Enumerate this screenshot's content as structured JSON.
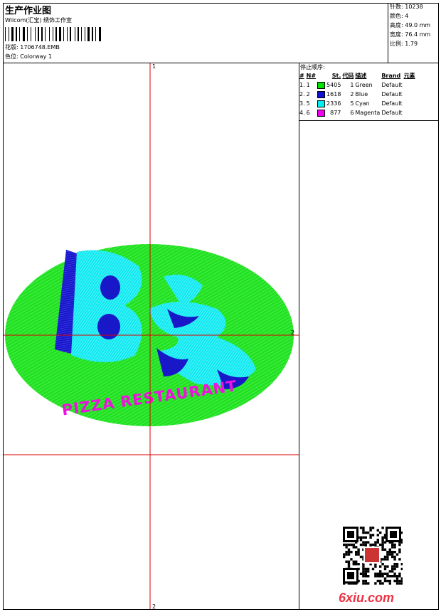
{
  "header": {
    "title": "生产作业图",
    "company": "Wilcom(汇宝) 绣饰工作室",
    "design_label": "花版:",
    "design_file": "1706748.EMB",
    "colorway_label": "色位:",
    "colorway": "Colorway 1"
  },
  "stats": [
    {
      "label": "针数:",
      "value": "10238"
    },
    {
      "label": "颜色:",
      "value": "4"
    },
    {
      "label": "高度:",
      "value": "49.0 mm"
    },
    {
      "label": "宽度:",
      "value": "76.4 mm"
    },
    {
      "label": "比例:",
      "value": "1.79"
    }
  ],
  "stop_sequence": {
    "heading": "停止顺序:",
    "columns": [
      "#",
      "N#",
      "St.",
      "代码",
      "描述",
      "Brand",
      "元素"
    ],
    "rows": [
      {
        "idx": "1.",
        "n": "1",
        "color": "#00e000",
        "st": "5405",
        "code": "1",
        "desc": "Green",
        "brand": "Default"
      },
      {
        "idx": "2.",
        "n": "2",
        "color": "#1010d0",
        "st": "1618",
        "code": "2",
        "desc": "Blue",
        "brand": "Default"
      },
      {
        "idx": "3.",
        "n": "5",
        "color": "#00f0f0",
        "st": "2336",
        "code": "5",
        "desc": "Cyan",
        "brand": "Default"
      },
      {
        "idx": "4.",
        "n": "6",
        "color": "#f000f0",
        "st": "877",
        "code": "6",
        "desc": "Magenta",
        "brand": "Default"
      }
    ]
  },
  "design": {
    "text_main": "B's",
    "text_sub": "PIZZA RESTAURANT",
    "axis_labels": {
      "top": "1",
      "bottom": "2",
      "right": "2"
    }
  },
  "watermark": "6xiu.com"
}
